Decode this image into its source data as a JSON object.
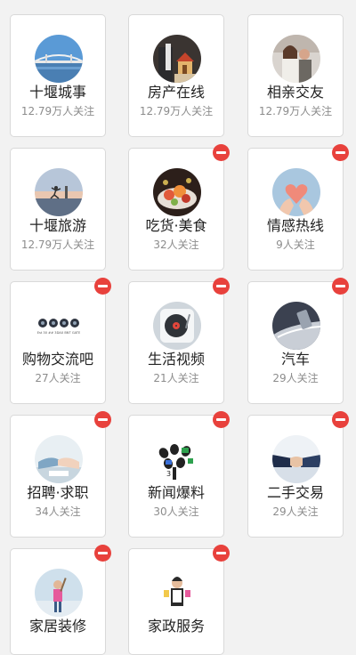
{
  "colors": {
    "page_background": "#f2f2f2",
    "card_background": "#ffffff",
    "remove_badge": "#e8413c",
    "title_text": "#222222",
    "subtitle_text": "#8c8c8c"
  },
  "groups": [
    {
      "title": "十堰城事",
      "followers": "12.79万人关注",
      "removable": false,
      "icon": "bridge-photo-icon"
    },
    {
      "title": "房产在线",
      "followers": "12.79万人关注",
      "removable": false,
      "icon": "house-model-photo-icon"
    },
    {
      "title": "相亲交友",
      "followers": "12.79万人关注",
      "removable": false,
      "icon": "couple-photo-icon"
    },
    {
      "title": "十堰旅游",
      "followers": "12.79万人关注",
      "removable": false,
      "icon": "sunset-jump-photo-icon"
    },
    {
      "title": "吃货·美食",
      "followers": "32人关注",
      "removable": true,
      "icon": "food-platter-photo-icon"
    },
    {
      "title": "情感热线",
      "followers": "9人关注",
      "removable": true,
      "icon": "heart-hands-photo-icon"
    },
    {
      "title": "购物交流吧",
      "followers": "27人关注",
      "removable": true,
      "icon": "shopping-badges-icon"
    },
    {
      "title": "生活视频",
      "followers": "21人关注",
      "removable": true,
      "icon": "record-player-icon"
    },
    {
      "title": "汽车",
      "followers": "29人关注",
      "removable": true,
      "icon": "car-photo-icon"
    },
    {
      "title": "招聘·求职",
      "followers": "34人关注",
      "removable": true,
      "icon": "handshake-desk-photo-icon"
    },
    {
      "title": "新闻爆料",
      "followers": "30人关注",
      "removable": true,
      "icon": "microphones-icon"
    },
    {
      "title": "二手交易",
      "followers": "29人关注",
      "removable": true,
      "icon": "business-handshake-photo-icon"
    },
    {
      "title": "家居装修",
      "followers": "",
      "removable": true,
      "icon": "painter-photo-icon"
    },
    {
      "title": "家政服务",
      "followers": "",
      "removable": true,
      "icon": "cleaner-photo-icon"
    }
  ],
  "shopping_badge_text": "Est 30 ## 3DAX BNT GATE"
}
